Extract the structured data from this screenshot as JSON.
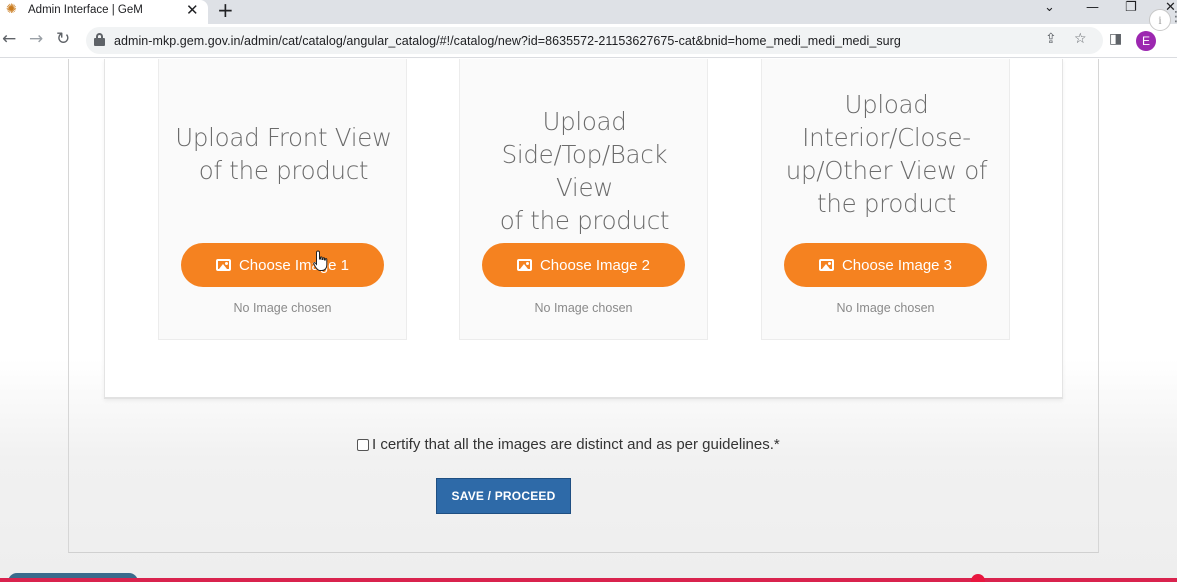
{
  "browser": {
    "tab": {
      "title": "Admin Interface | GeM",
      "favicon": "gem-logo-icon",
      "close_glyph": "✕"
    },
    "new_tab_glyph": "+",
    "window_controls": {
      "dropdown": "⌄",
      "minimize": "—",
      "restore": "❐",
      "close": "✕"
    },
    "nav": {
      "back": "←",
      "forward": "→",
      "reload": "↻"
    },
    "address": "admin-mkp.gem.gov.in/admin/cat/catalog/angular_catalog/#!/catalog/new?id=8635572-21153627675-cat&bnid=home_medi_medi_medi_surg",
    "toolbar_icons": {
      "share": "⇪",
      "bookmark": "☆",
      "sidepanel": "◨",
      "menu": "⋮"
    },
    "profile_initial": "E",
    "info_badge": "i"
  },
  "upload_cards": [
    {
      "title_lines": [
        "Upload Front View",
        "of the product"
      ],
      "button_label": "Choose Image 1",
      "status": "No Image chosen"
    },
    {
      "title_lines": [
        "Upload",
        "Side/Top/Back View",
        "of the product"
      ],
      "button_label": "Choose Image 2",
      "status": "No Image chosen"
    },
    {
      "title_lines": [
        "Upload",
        "Interior/Close-",
        "up/Other View of",
        "the product"
      ],
      "button_label": "Choose Image 3",
      "status": "No Image chosen"
    }
  ],
  "certification": {
    "checked": false,
    "label": "I certify that all the images are distinct and as per guidelines.*"
  },
  "save_button": {
    "label": "SAVE / PROCEED"
  },
  "colors": {
    "accent_orange": "#f58220",
    "save_blue": "#2e6aa8",
    "progress_red": "#d9234e"
  }
}
